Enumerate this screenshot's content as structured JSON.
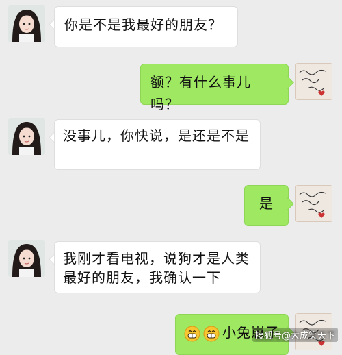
{
  "colors": {
    "background": "#ececec",
    "sent_bubble": "#9ee862",
    "received_bubble": "#ffffff"
  },
  "messages": [
    {
      "side": "left",
      "avatar": "girl-avatar",
      "text": "你是不是我最好的朋友？"
    },
    {
      "side": "right",
      "avatar": "handwriting-avatar",
      "text": "额？有什么事儿吗？"
    },
    {
      "side": "left",
      "avatar": "girl-avatar",
      "text": "没事儿，你快说，是还是不是"
    },
    {
      "side": "right",
      "avatar": "handwriting-avatar",
      "text": "是"
    },
    {
      "side": "left",
      "avatar": "girl-avatar",
      "text": "我刚才看电视，说狗才是人类最好的朋友，我确认一下"
    },
    {
      "side": "right",
      "avatar": "handwriting-avatar",
      "emoji": [
        "grin-emoji",
        "grin-emoji"
      ],
      "text": "小兔崽子"
    }
  ],
  "avatar_right_text": "No regrets, y girl",
  "watermark": "搜狐号@大成笑天下"
}
